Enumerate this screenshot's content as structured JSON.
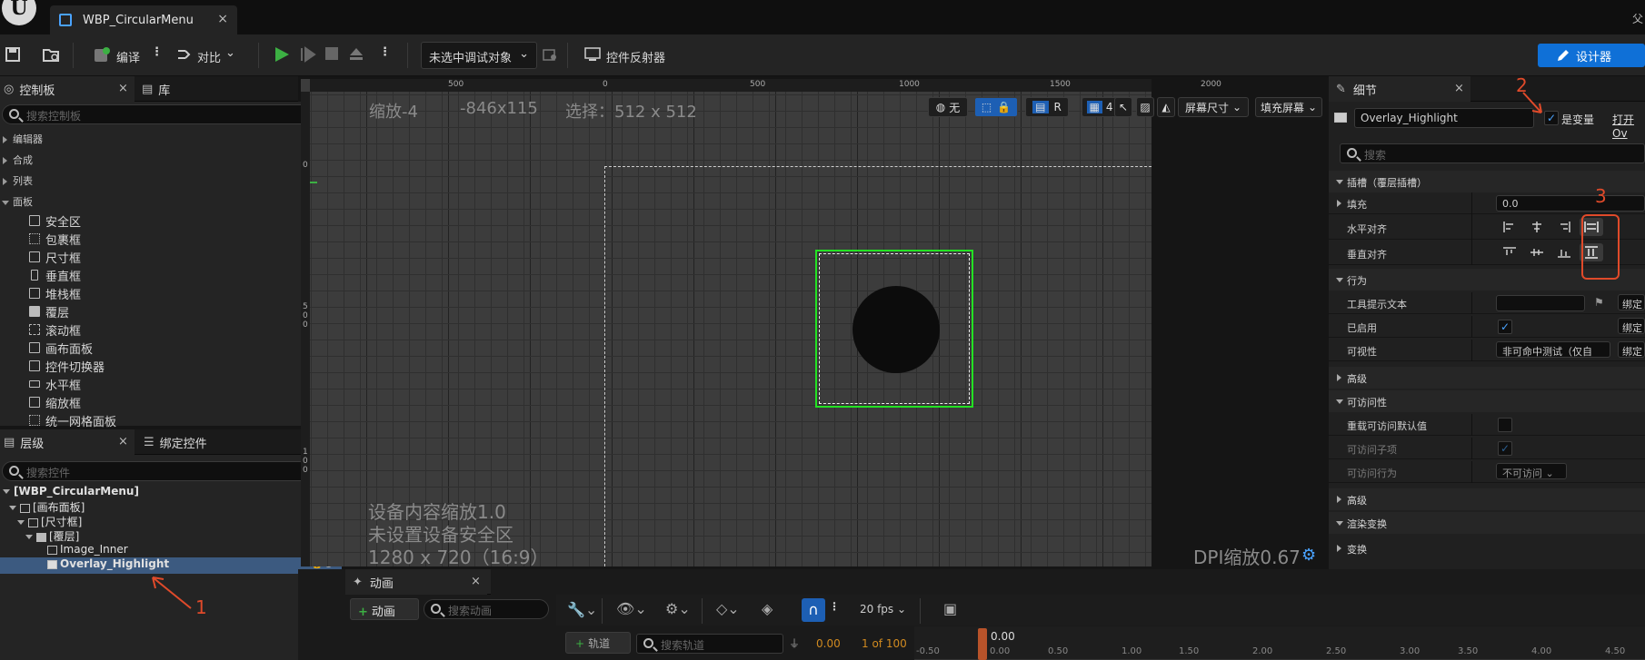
{
  "window": {
    "logo_text": "U",
    "tab_title": "WBP_CircularMenu",
    "close": "×"
  },
  "toolbar": {
    "compile": "编译",
    "diff": "对比",
    "debug_object": "未选中调试对象",
    "reflector": "控件反射器",
    "designer": "设计器",
    "corner_text": "父"
  },
  "palette": {
    "tab": "控制板",
    "library_tab": "库",
    "search_placeholder": "搜索控制板",
    "categories": [
      "编辑器",
      "合成",
      "列表",
      "面板"
    ],
    "items": [
      "安全区",
      "包裹框",
      "尺寸框",
      "垂直框",
      "堆栈框",
      "覆层",
      "滚动框",
      "画布面板",
      "控件切换器",
      "水平框",
      "缩放框",
      "统一网格面板"
    ]
  },
  "hierarchy": {
    "tab": "层级",
    "bind_tab": "绑定控件",
    "search_placeholder": "搜索控件",
    "nodes": [
      "[WBP_CircularMenu]",
      "[画布面板]",
      "[尺寸框]",
      "[覆层]",
      "Image_Inner",
      "Overlay_Highlight"
    ]
  },
  "viewport": {
    "zoom": "缩放-4",
    "size": "-846x115",
    "selection": "选择：512 x 512",
    "ruler_top": [
      "500",
      "0",
      "500",
      "1000",
      "1500",
      "2000"
    ],
    "ruler_left": [
      "0",
      "5",
      "0",
      "0",
      "1",
      "0",
      "0"
    ],
    "none_label": "无",
    "r_label": "R",
    "grid_count": "4",
    "screen_size": "屏幕尺寸",
    "fill_screen": "填充屏幕",
    "device_scale": "设备内容缩放1.0",
    "no_safe_zone": "未设置设备安全区",
    "resolution": "1280 x 720（16:9）",
    "dpi": "DPI缩放0.67"
  },
  "details": {
    "tab": "细节",
    "name_value": "Overlay_Highlight",
    "is_variable": "是变量",
    "open_link": "打开Ov",
    "search_placeholder": "搜索",
    "sections": {
      "slot": "插槽（覆层插槽）",
      "behavior": "行为",
      "advanced1": "高级",
      "accessibility": "可访问性",
      "advanced2": "高级",
      "render_transform": "渲染变换",
      "transform": "变换"
    },
    "rows": {
      "padding": "填充",
      "padding_value": "0.0",
      "h_align": "水平对齐",
      "v_align": "垂直对齐",
      "tooltip": "工具提示文本",
      "bind": "绑定",
      "enabled": "已启用",
      "visibility": "可视性",
      "visibility_value": "非可命中测试（仅自",
      "override_access": "重载可访问默认值",
      "access_children": "可访问子项",
      "access_behavior": "可访问行为",
      "access_behavior_value": "不可访问"
    }
  },
  "animation": {
    "tab": "动画",
    "add_button": "动画",
    "search_placeholder": "搜索动画",
    "fps": "20 fps",
    "track_button": "轨道",
    "track_search": "搜索轨道",
    "time_value": "0.00",
    "frame_counter": "1 of 100",
    "playhead": "0.00",
    "timeline_ticks": [
      "-0.50",
      "0.00",
      "0.50",
      "1.00",
      "1.50",
      "2.00",
      "2.50",
      "3.00",
      "3.50",
      "4.00",
      "4.50"
    ]
  },
  "annotations": [
    "1",
    "2",
    "3"
  ]
}
